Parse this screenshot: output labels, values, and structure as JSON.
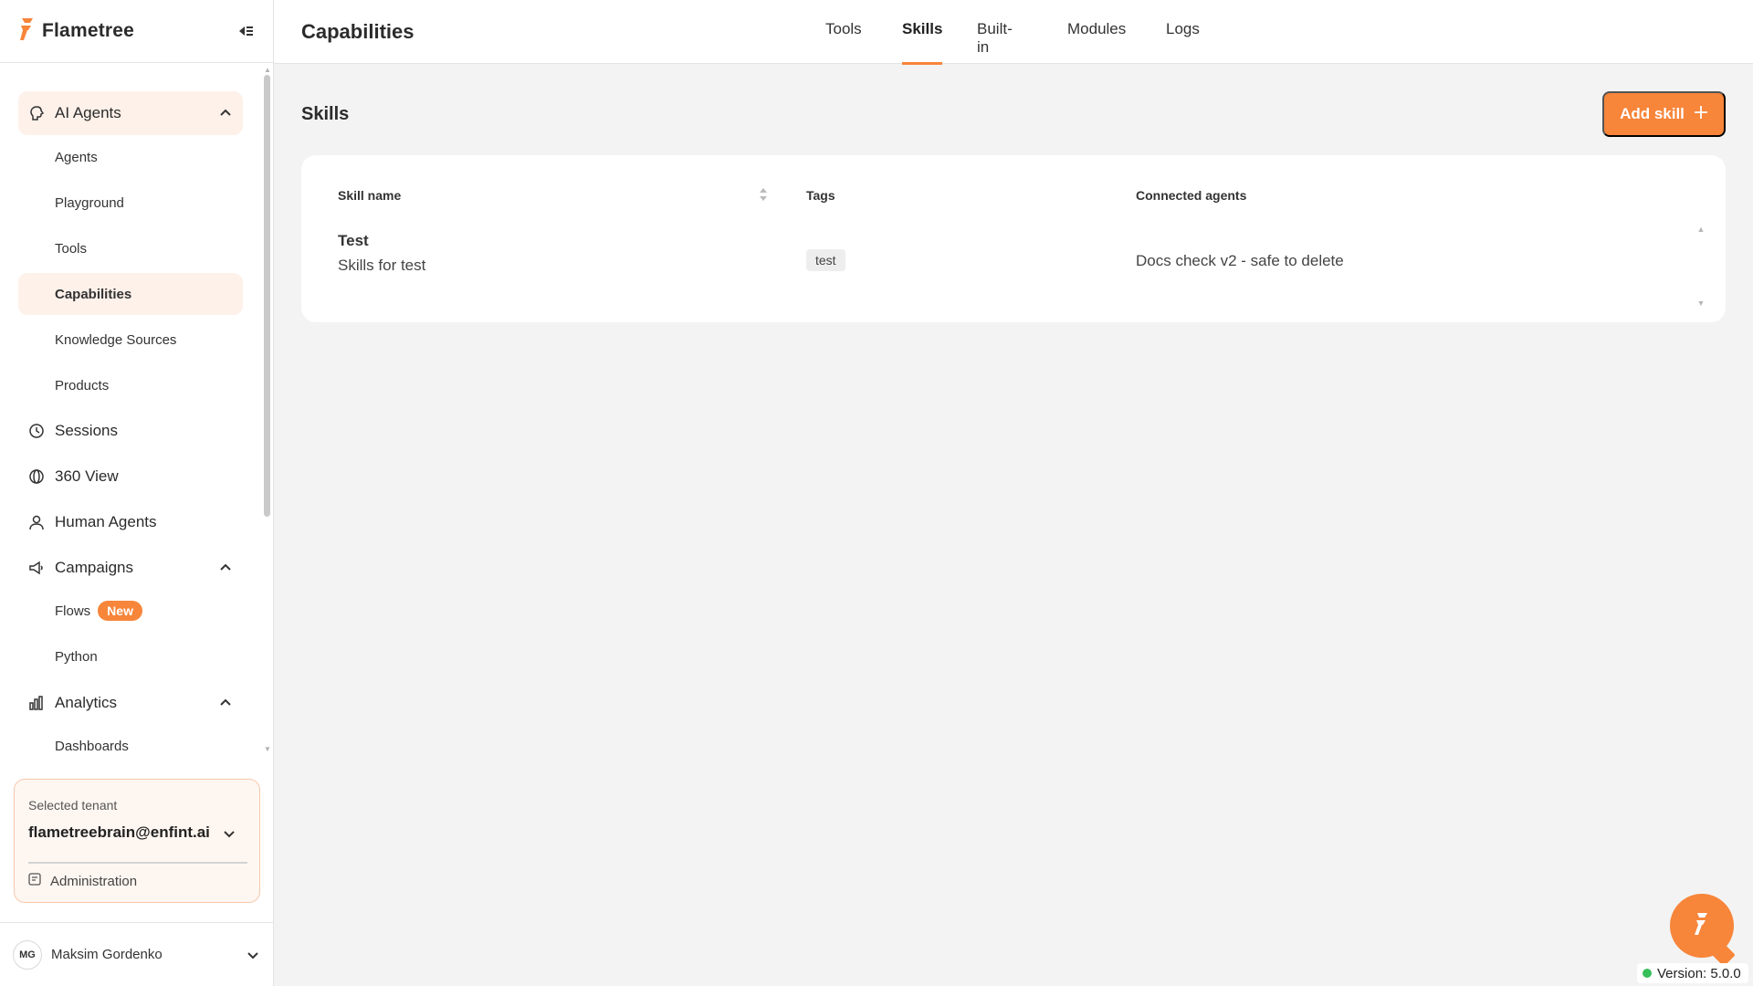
{
  "brand": {
    "name": "Flametree"
  },
  "sidebar": {
    "ai_agents": {
      "label": "AI Agents",
      "items": [
        "Agents",
        "Playground",
        "Tools",
        "Capabilities",
        "Knowledge Sources",
        "Products"
      ]
    },
    "sessions": "Sessions",
    "view360": "360 View",
    "human_agents": "Human Agents",
    "campaigns": {
      "label": "Campaigns",
      "items": [
        "Flows",
        "Python"
      ],
      "flows_badge": "New"
    },
    "analytics": {
      "label": "Analytics",
      "items": [
        "Dashboards"
      ]
    }
  },
  "tenant": {
    "label": "Selected tenant",
    "value": "flametreebrain@enfint.ai",
    "admin": "Administration"
  },
  "user": {
    "initials": "MG",
    "name": "Maksim Gordenko"
  },
  "header": {
    "title": "Capabilities",
    "tabs": [
      "Tools",
      "Skills",
      "Built-in",
      "Modules",
      "Logs"
    ],
    "active_tab": "Skills"
  },
  "main": {
    "section_title": "Skills",
    "add_button": "Add skill",
    "table": {
      "columns": [
        "Skill name",
        "Tags",
        "Connected agents"
      ],
      "rows": [
        {
          "name": "Test",
          "description": "Skills for test",
          "tag": "test",
          "agents": "Docs check v2 - safe to delete"
        }
      ]
    }
  },
  "version": "Version: 5.0.0",
  "colors": {
    "accent": "#f7853a",
    "active_bg": "#fdf1ea",
    "background": "#f3f3f3",
    "status": "#37c05a"
  }
}
